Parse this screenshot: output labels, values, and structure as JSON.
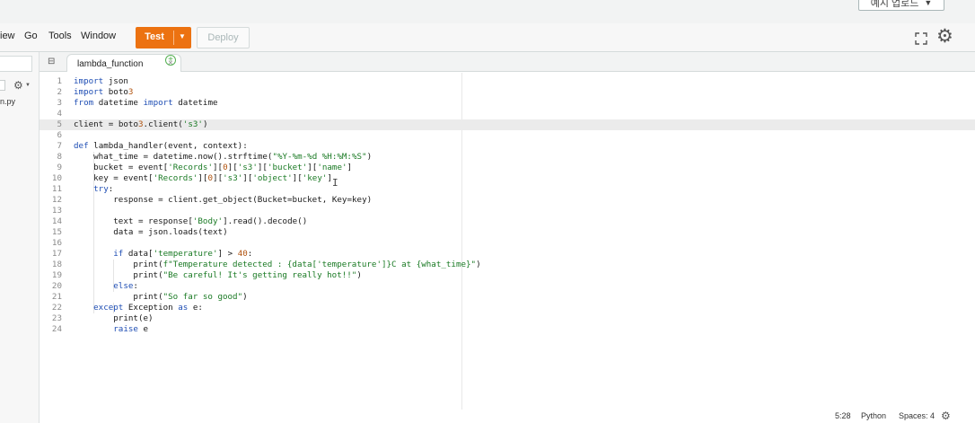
{
  "top": {
    "upload_label": "예시 업로드"
  },
  "menu": {
    "items": [
      "iew",
      "Go",
      "Tools",
      "Window"
    ],
    "test_label": "Test",
    "deploy_label": "Deploy"
  },
  "sidebar": {
    "file_label": "n.py"
  },
  "tabs": [
    {
      "label": "lambda_function",
      "close": "×"
    }
  ],
  "editor": {
    "lines": [
      {
        "n": "1",
        "code": "import json"
      },
      {
        "n": "2",
        "code": "import boto3"
      },
      {
        "n": "3",
        "code": "from datetime import datetime"
      },
      {
        "n": "4",
        "code": ""
      },
      {
        "n": "5",
        "code": "client = boto3.client('s3')"
      },
      {
        "n": "6",
        "code": ""
      },
      {
        "n": "7",
        "code": "def lambda_handler(event, context):"
      },
      {
        "n": "8",
        "code": "    what_time = datetime.now().strftime(\"%Y-%m-%d %H:%M:%S\")"
      },
      {
        "n": "9",
        "code": "    bucket = event['Records'][0]['s3']['bucket']['name']"
      },
      {
        "n": "10",
        "code": "    key = event['Records'][0]['s3']['object']['key']"
      },
      {
        "n": "11",
        "code": "    try:"
      },
      {
        "n": "12",
        "code": "        response = client.get_object(Bucket=bucket, Key=key)"
      },
      {
        "n": "13",
        "code": ""
      },
      {
        "n": "14",
        "code": "        text = response['Body'].read().decode()"
      },
      {
        "n": "15",
        "code": "        data = json.loads(text)"
      },
      {
        "n": "16",
        "code": ""
      },
      {
        "n": "17",
        "code": "        if data['temperature'] > 40:"
      },
      {
        "n": "18",
        "code": "            print(f\"Temperature detected : {data['temperature']}C at {what_time}\")"
      },
      {
        "n": "19",
        "code": "            print(\"Be careful! It's getting really hot!!\")"
      },
      {
        "n": "20",
        "code": "        else:"
      },
      {
        "n": "21",
        "code": "            print(\"So far so good\")"
      },
      {
        "n": "22",
        "code": "    except Exception as e:"
      },
      {
        "n": "23",
        "code": "        print(e)"
      },
      {
        "n": "24",
        "code": "        raise e"
      }
    ]
  },
  "status": {
    "position": "5:28",
    "language": "Python",
    "spaces": "Spaces: 4"
  },
  "colors": {
    "test_button": "#ec7211",
    "keyword": "#1f4eb4",
    "string": "#1a7a24",
    "line_number": "#8a8a8a"
  }
}
